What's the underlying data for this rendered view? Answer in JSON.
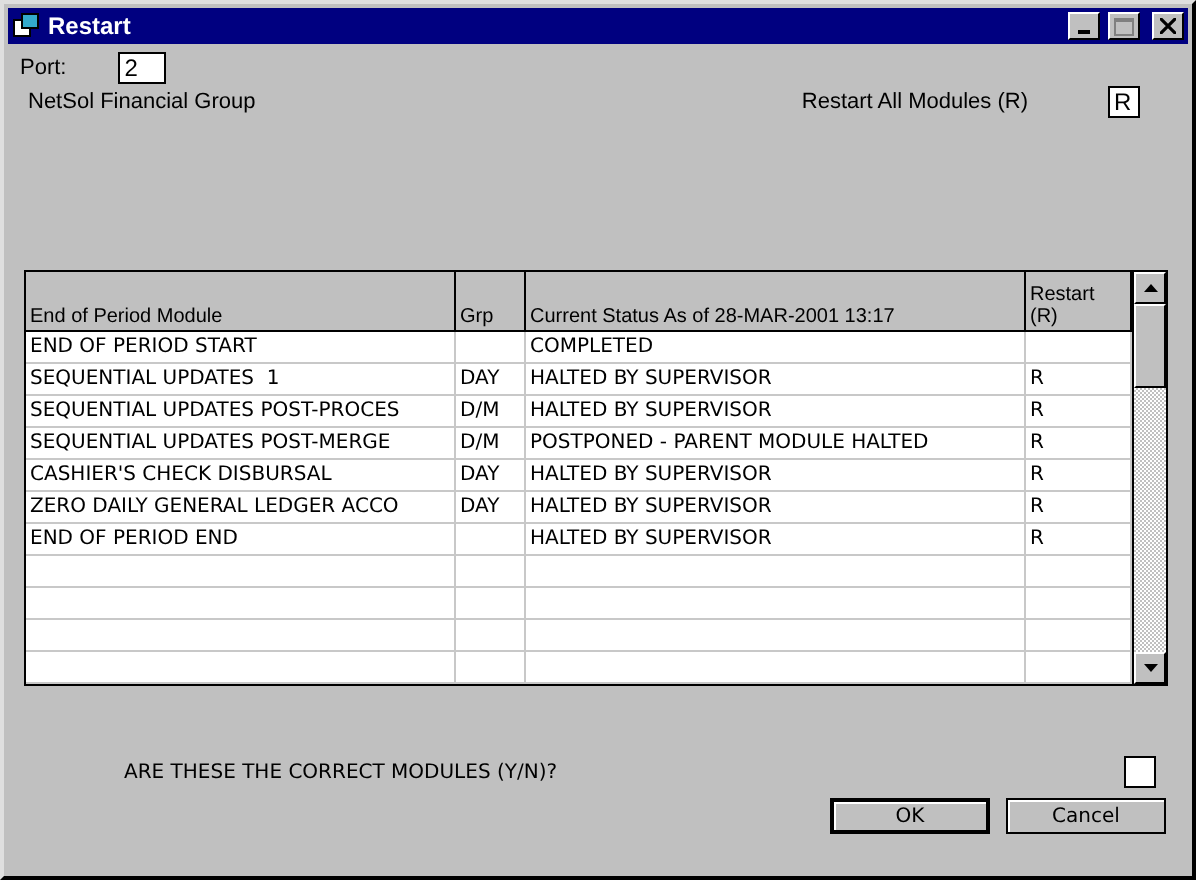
{
  "window": {
    "title": "Restart"
  },
  "port": {
    "label": "Port:",
    "value": "2"
  },
  "company": "NetSol Financial Group",
  "restart_all": {
    "label": "Restart All Modules (R)",
    "value": "R"
  },
  "table": {
    "columns": [
      "End of Period Module",
      "Grp",
      "Current Status As of 28-MAR-2001 13:17",
      "Restart (R)"
    ],
    "rows": [
      {
        "module": "END OF PERIOD START",
        "grp": "",
        "status": "COMPLETED",
        "restart": ""
      },
      {
        "module": "SEQUENTIAL UPDATES  1",
        "grp": "DAY",
        "status": "HALTED BY SUPERVISOR",
        "restart": "R"
      },
      {
        "module": "SEQUENTIAL UPDATES POST-PROCES",
        "grp": "D/M",
        "status": "HALTED BY SUPERVISOR",
        "restart": "R"
      },
      {
        "module": "SEQUENTIAL UPDATES POST-MERGE",
        "grp": "D/M",
        "status": "POSTPONED - PARENT MODULE HALTED",
        "restart": "R"
      },
      {
        "module": "CASHIER'S CHECK DISBURSAL",
        "grp": "DAY",
        "status": "HALTED BY SUPERVISOR",
        "restart": "R"
      },
      {
        "module": "ZERO DAILY GENERAL LEDGER ACCO",
        "grp": "DAY",
        "status": "HALTED BY SUPERVISOR",
        "restart": "R"
      },
      {
        "module": "END OF PERIOD END",
        "grp": "",
        "status": "HALTED BY SUPERVISOR",
        "restart": "R"
      }
    ]
  },
  "confirm": {
    "label": "ARE THESE THE CORRECT MODULES (Y/N)?"
  },
  "buttons": [
    {
      "label": "OK",
      "default": true
    },
    {
      "label": "Cancel",
      "default": false
    }
  ]
}
